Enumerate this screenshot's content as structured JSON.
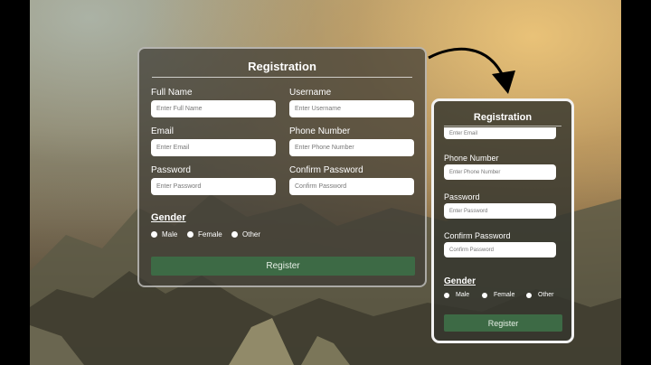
{
  "desktop_form": {
    "title": "Registration",
    "fields": {
      "full_name": {
        "label": "Full Name",
        "placeholder": "Enter Full Name"
      },
      "username": {
        "label": "Username",
        "placeholder": "Enter Username"
      },
      "email": {
        "label": "Email",
        "placeholder": "Enter Email"
      },
      "phone": {
        "label": "Phone Number",
        "placeholder": "Enter Phone Number"
      },
      "password": {
        "label": "Password",
        "placeholder": "Enter Password"
      },
      "confirm_password": {
        "label": "Confirm Password",
        "placeholder": "Confirm Password"
      }
    },
    "gender": {
      "title": "Gender",
      "options": [
        "Male",
        "Female",
        "Other"
      ]
    },
    "register_label": "Register"
  },
  "mobile_form": {
    "title": "Registration",
    "email_placeholder": "Enter Email",
    "fields": {
      "phone": {
        "label": "Phone Number",
        "placeholder": "Enter Phone Number"
      },
      "password": {
        "label": "Password",
        "placeholder": "Enter Password"
      },
      "confirm_password": {
        "label": "Confirm Password",
        "placeholder": "Confirm Password"
      }
    },
    "gender": {
      "title": "Gender",
      "options": [
        "Male",
        "Female",
        "Other"
      ]
    },
    "register_label": "Register"
  },
  "colors": {
    "button": "#3d6a45",
    "card_bg": "rgba(62,60,52,0.72)",
    "card_border": "#ffffff"
  }
}
